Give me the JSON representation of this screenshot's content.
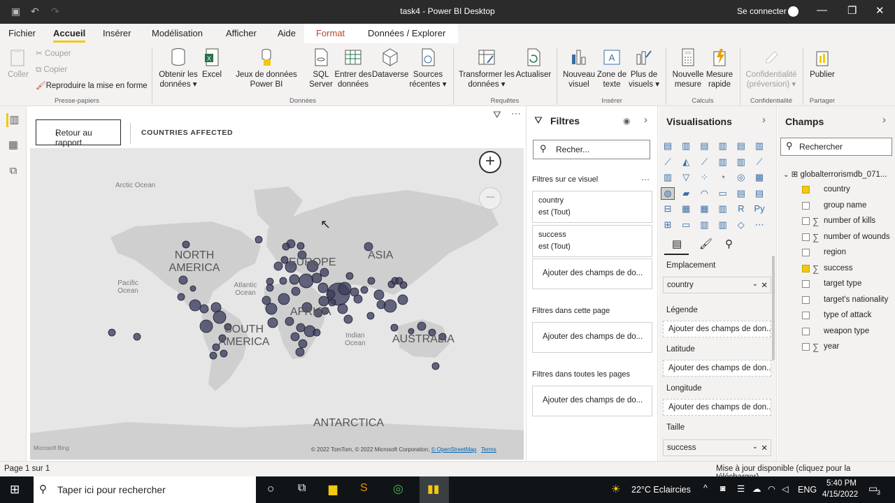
{
  "window": {
    "title": "task4 - Power BI Desktop",
    "signin": "Se connecter"
  },
  "menu": {
    "items": [
      "Fichier",
      "Accueil",
      "Insérer",
      "Modélisation",
      "Afficher",
      "Aide"
    ],
    "context": [
      "Format",
      "Données / Explorer"
    ]
  },
  "ribbon": {
    "clipboard": {
      "paste": "Coller",
      "cut": "Couper",
      "copy": "Copier",
      "format_painter": "Reproduire la mise en forme",
      "group": "Presse-papiers"
    },
    "data": {
      "get_data": "Obtenir les données",
      "excel": "Excel",
      "datasets": "Jeux de données Power BI",
      "sql": "SQL Server",
      "enter": "Entrer des données",
      "dataverse": "Dataverse",
      "recent": "Sources récentes",
      "group": "Données"
    },
    "queries": {
      "transform": "Transformer les données",
      "refresh": "Actualiser",
      "group": "Requêtes"
    },
    "insert": {
      "new_visual": "Nouveau visuel",
      "textbox": "Zone de texte",
      "more_visuals": "Plus de visuels",
      "group": "Insérer"
    },
    "calc": {
      "new_measure": "Nouvelle mesure",
      "quick_measure": "Mesure rapide",
      "group": "Calculs"
    },
    "confidentiality": {
      "label": "Confidentialité (préversion)",
      "group": "Confidentialité"
    },
    "share": {
      "publish": "Publier",
      "group": "Partager"
    }
  },
  "canvas": {
    "back_button": "Retour au rapport",
    "visual_title": "COUNTRIES AFFECTED",
    "map": {
      "labels": {
        "arctic": "Arctic Ocean",
        "north_america": "NORTH AMERICA",
        "pacific": "Pacific Ocean",
        "atlantic": "Atlantic Ocean",
        "europe": "EUROPE",
        "asia": "ASIA",
        "africa": "AFRICA",
        "south_america": "SOUTH AMERICA",
        "indian": "Indian Ocean",
        "australia": "AUSTRALIA",
        "antarctica": "ANTARCTICA"
      },
      "bing": "Microsoft Bing",
      "copyright": "© 2022 TomTom, © 2022 Microsoft Corporation,",
      "osm": "© OpenStreetMap",
      "terms": "Terms",
      "zoom_in": "+",
      "zoom_out": "−"
    }
  },
  "filters": {
    "title": "Filtres",
    "search": "Recher...",
    "on_visual": "Filtres sur ce visuel",
    "cards": [
      {
        "field": "country",
        "state": "est (Tout)"
      },
      {
        "field": "success",
        "state": "est (Tout)"
      }
    ],
    "add": "Ajouter des champs de do...",
    "on_page": "Filtres dans cette page",
    "all_pages": "Filtres dans toutes les pages"
  },
  "viz": {
    "title": "Visualisations",
    "wells": {
      "location": {
        "label": "Emplacement",
        "value": "country"
      },
      "legend": {
        "label": "Légende",
        "value": "Ajouter des champs de don..."
      },
      "latitude": {
        "label": "Latitude",
        "value": "Ajouter des champs de don..."
      },
      "longitude": {
        "label": "Longitude",
        "value": "Ajouter des champs de don..."
      },
      "size": {
        "label": "Taille",
        "value": "success"
      }
    }
  },
  "fields": {
    "title": "Champs",
    "search": "Rechercher",
    "table": "globalterrorismdb_071...",
    "items": [
      {
        "name": "country",
        "checked": true,
        "sigma": false
      },
      {
        "name": "group name",
        "checked": false,
        "sigma": false
      },
      {
        "name": "number of kills",
        "checked": false,
        "sigma": true
      },
      {
        "name": "number of wounds",
        "checked": false,
        "sigma": true
      },
      {
        "name": "region",
        "checked": false,
        "sigma": false
      },
      {
        "name": "success",
        "checked": true,
        "sigma": true
      },
      {
        "name": "target type",
        "checked": false,
        "sigma": false
      },
      {
        "name": "target's nationality",
        "checked": false,
        "sigma": false
      },
      {
        "name": "type of attack",
        "checked": false,
        "sigma": false
      },
      {
        "name": "weapon type",
        "checked": false,
        "sigma": false
      },
      {
        "name": "year",
        "checked": false,
        "sigma": true
      }
    ]
  },
  "status": {
    "page": "Page 1 sur 1",
    "update": "Mise à jour disponible (cliquez pour la télécharger)"
  },
  "taskbar": {
    "search": "Taper ici pour rechercher",
    "weather": "22°C  Eclaircies",
    "lang": "ENG",
    "time": "5:40 PM",
    "date": "4/15/2022",
    "notif": "3"
  }
}
